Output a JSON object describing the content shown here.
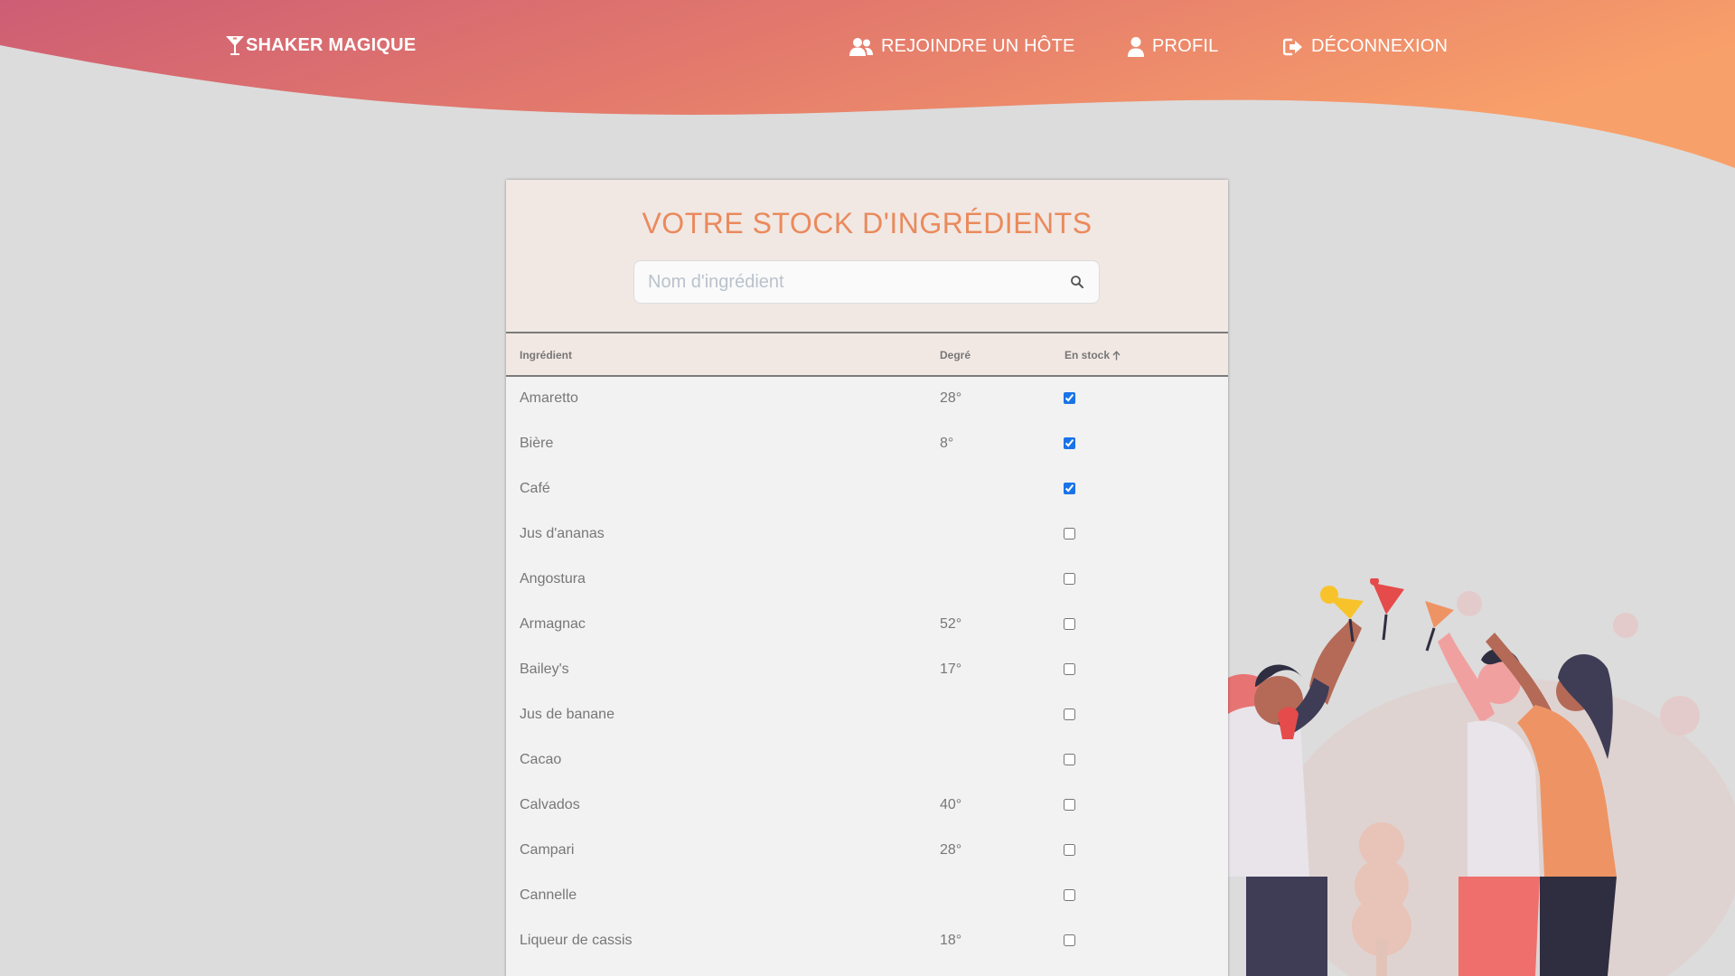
{
  "nav": {
    "brand": "SHAKER MAGIQUE",
    "join_host": "REJOINDRE UN HÔTE",
    "profile": "PROFIL",
    "logout": "DÉCONNEXION"
  },
  "stock": {
    "title": "VOTRE STOCK D'INGRÉDIENTS",
    "search_placeholder": "Nom d'ingrédient",
    "search_value": ""
  },
  "table": {
    "headers": {
      "ingredient": "Ingrédient",
      "degree": "Degré",
      "in_stock": "En stock",
      "sort": "ascending"
    },
    "rows": [
      {
        "name": "Amaretto",
        "degree": "28°",
        "in_stock": true
      },
      {
        "name": "Bière",
        "degree": "8°",
        "in_stock": true
      },
      {
        "name": "Café",
        "degree": "",
        "in_stock": true
      },
      {
        "name": "Jus d'ananas",
        "degree": "",
        "in_stock": false
      },
      {
        "name": "Angostura",
        "degree": "",
        "in_stock": false
      },
      {
        "name": "Armagnac",
        "degree": "52°",
        "in_stock": false
      },
      {
        "name": "Bailey's",
        "degree": "17°",
        "in_stock": false
      },
      {
        "name": "Jus de banane",
        "degree": "",
        "in_stock": false
      },
      {
        "name": "Cacao",
        "degree": "",
        "in_stock": false
      },
      {
        "name": "Calvados",
        "degree": "40°",
        "in_stock": false
      },
      {
        "name": "Campari",
        "degree": "28°",
        "in_stock": false
      },
      {
        "name": "Cannelle",
        "degree": "",
        "in_stock": false
      },
      {
        "name": "Liqueur de cassis",
        "degree": "18°",
        "in_stock": false
      }
    ]
  },
  "icons": {
    "brand": "cocktail-glass-icon",
    "join_host": "users-icon",
    "profile": "user-icon",
    "logout": "sign-out-icon",
    "search": "search-icon",
    "sort": "arrow-up-icon"
  },
  "colors": {
    "header_gradient_start": "#cf5f74",
    "header_gradient_end": "#f8a06a",
    "title": "#ea8a5c",
    "background": "#dcdcdc",
    "card": "#f2f2f2",
    "card_header": "#f1e8e4"
  }
}
